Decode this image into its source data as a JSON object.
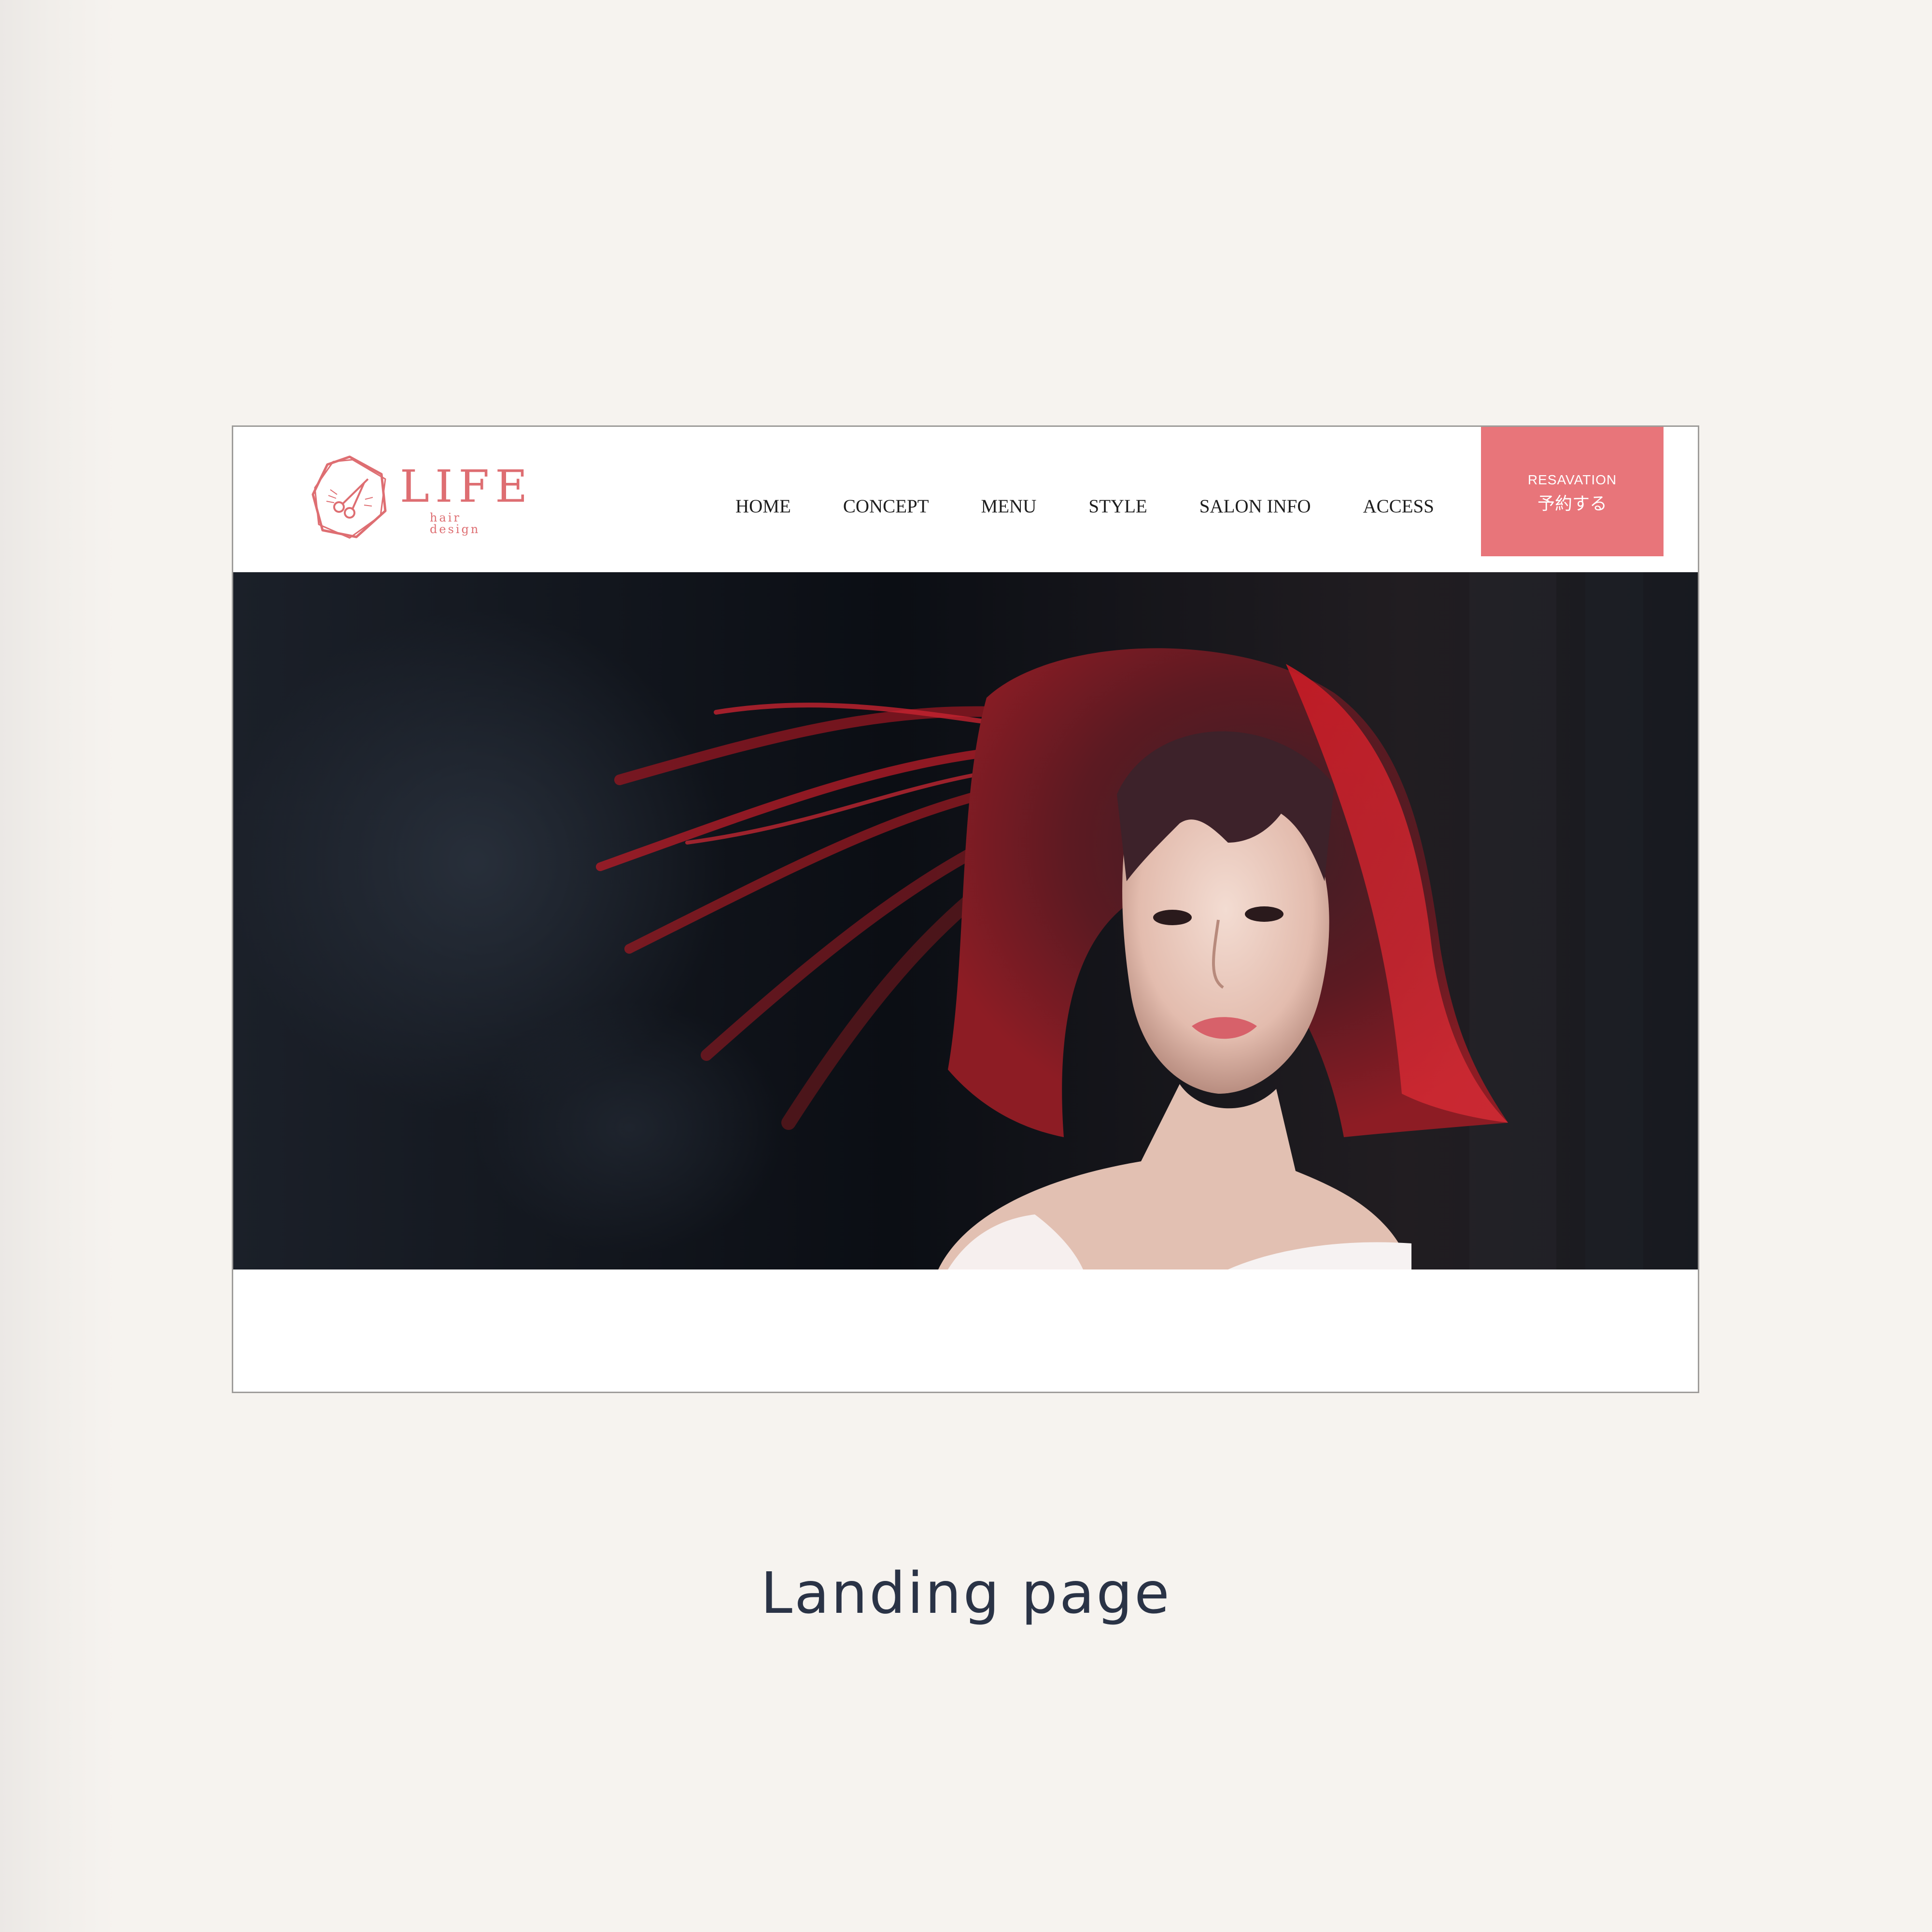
{
  "brand": {
    "name": "LIFE",
    "tagline": "hair design",
    "color": "#de6e72"
  },
  "nav": {
    "items": [
      "HOME",
      "CONCEPT",
      "MENU",
      "STYLE",
      "SALON INFO",
      "ACCESS"
    ]
  },
  "reserve": {
    "label_en": "RESAVATION",
    "label_ja": "予約する",
    "color": "#e8757a"
  },
  "hero": {
    "icon": "hero-portrait-image"
  },
  "caption": "Landing page",
  "colors": {
    "background": "#f6f3ef",
    "caption_text": "#2a3346",
    "mockup_border": "#9e9c9a"
  }
}
